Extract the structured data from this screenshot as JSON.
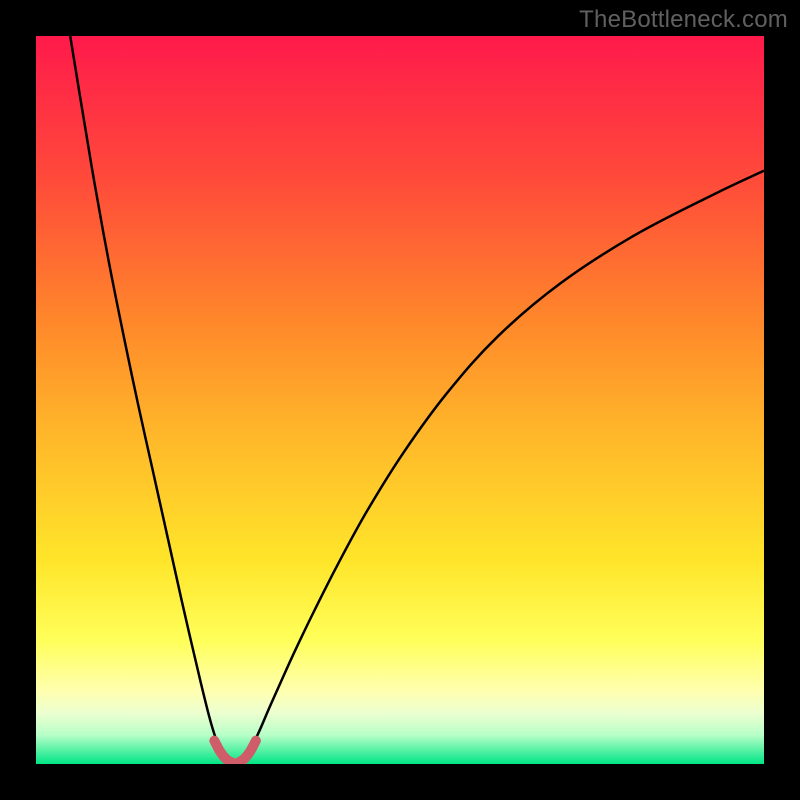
{
  "watermark": "TheBottleneck.com",
  "chart_data": {
    "type": "line",
    "title": "",
    "xlabel": "",
    "ylabel": "",
    "xlim": [
      0,
      100
    ],
    "ylim": [
      0,
      100
    ],
    "grid": false,
    "legend": false,
    "background_gradient": {
      "stops": [
        {
          "offset": 0.0,
          "color": "#ff1a4b"
        },
        {
          "offset": 0.2,
          "color": "#ff4b3a"
        },
        {
          "offset": 0.4,
          "color": "#ff8a2a"
        },
        {
          "offset": 0.55,
          "color": "#ffb82a"
        },
        {
          "offset": 0.72,
          "color": "#ffe52a"
        },
        {
          "offset": 0.83,
          "color": "#ffff5a"
        },
        {
          "offset": 0.9,
          "color": "#ffffb0"
        },
        {
          "offset": 0.93,
          "color": "#ecffd0"
        },
        {
          "offset": 0.96,
          "color": "#b8ffc8"
        },
        {
          "offset": 1.0,
          "color": "#00e585"
        }
      ]
    },
    "series": [
      {
        "name": "curve-left",
        "stroke": "#000000",
        "stroke_width": 2.5,
        "x": [
          4.7,
          6,
          8,
          10,
          12,
          14,
          16,
          18,
          20,
          21.5,
          22.8,
          23.8,
          24.6,
          25.3,
          25.8,
          26.2,
          26.4
        ],
        "y": [
          100,
          92,
          80,
          69,
          59,
          49.5,
          40.5,
          31.5,
          22.5,
          16,
          10.5,
          6.5,
          3.8,
          2.0,
          0.9,
          0.3,
          0.1
        ]
      },
      {
        "name": "curve-right",
        "stroke": "#000000",
        "stroke_width": 2.5,
        "x": [
          28.2,
          28.5,
          29.0,
          29.8,
          30.8,
          32.0,
          33.6,
          35.6,
          38.2,
          41.5,
          45.5,
          50.5,
          56.5,
          63.5,
          72.0,
          82.0,
          93.0,
          100.0
        ],
        "y": [
          0.1,
          0.4,
          1.2,
          2.7,
          4.8,
          7.6,
          11.2,
          15.6,
          21.0,
          27.5,
          34.8,
          42.8,
          51.0,
          58.8,
          66.0,
          72.5,
          78.2,
          81.5
        ]
      },
      {
        "name": "trough-marker",
        "stroke": "#cf5d69",
        "stroke_width": 10,
        "linecap": "round",
        "linejoin": "round",
        "x": [
          24.5,
          25.3,
          26.1,
          26.9,
          27.3,
          27.8,
          28.6,
          29.4,
          30.2
        ],
        "y": [
          3.2,
          1.7,
          0.7,
          0.2,
          0.1,
          0.2,
          0.7,
          1.7,
          3.2
        ]
      }
    ]
  }
}
